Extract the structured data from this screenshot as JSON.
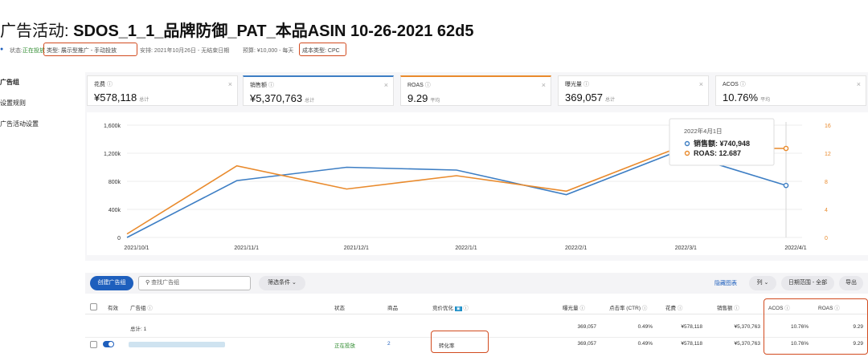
{
  "header": {
    "title_prefix": "广告活动: ",
    "title_name": "SDOS_1_1_品牌防御_PAT_本品ASIN 10-26-2021 62d5"
  },
  "status_bar": {
    "status_label": "状态:",
    "status_value": "正在投放",
    "type": "类型: 展示型推广 - 手动投放",
    "schedule": "安排: 2021年10月26日 - 无结束日期",
    "budget": "预算: ¥10,000 - 每天",
    "cost_type": "成本类型: CPC"
  },
  "sidebar": {
    "items": [
      {
        "label": "广告组"
      },
      {
        "label": "设置规则"
      },
      {
        "label": "广告活动设置"
      }
    ]
  },
  "metrics": [
    {
      "label": "花费",
      "value": "¥578,118",
      "suffix": "总计"
    },
    {
      "label": "销售额",
      "value": "¥5,370,763",
      "suffix": "总计"
    },
    {
      "label": "ROAS",
      "value": "9.29",
      "suffix": "平均"
    },
    {
      "label": "曝光量",
      "value": "369,057",
      "suffix": "总计"
    },
    {
      "label": "ACOS",
      "value": "10.76%",
      "suffix": "平均"
    }
  ],
  "chart_data": {
    "type": "line",
    "x": [
      "2021/10/1",
      "2021/11/1",
      "2021/12/1",
      "2022/1/1",
      "2022/2/1",
      "2022/3/1",
      "2022/4/1"
    ],
    "series": [
      {
        "name": "销售额",
        "color": "#3d7ec4",
        "axis": "left",
        "values": [
          0,
          810000,
          1000000,
          960000,
          610000,
          1220000,
          740948
        ]
      },
      {
        "name": "ROAS",
        "color": "#e98a2c",
        "axis": "right",
        "values": [
          0.5,
          10.2,
          6.9,
          8.8,
          6.6,
          12.7,
          12.687
        ]
      }
    ],
    "y_left": {
      "ticks": [
        "0",
        "400k",
        "800k",
        "1,200k",
        "1,600k"
      ],
      "max": 1600000
    },
    "y_right": {
      "ticks": [
        "0",
        "4",
        "8",
        "12",
        "16"
      ],
      "max": 16
    },
    "tooltip": {
      "date": "2022年4月1日",
      "sales_label": "销售额: ¥740,948",
      "roas_label": "ROAS: 12.687"
    }
  },
  "toolbar": {
    "create_button": "创建广告组",
    "search_placeholder": "查找广告组",
    "filter_button": "筛选条件",
    "hide_chart": "隐藏图表",
    "columns": "列",
    "date_range": "日期范围 - 全部",
    "export": "导出"
  },
  "table": {
    "headers": {
      "active": "有效",
      "ad_group": "广告组",
      "status": "状态",
      "products": "商品",
      "bid_opt": "竞价优化",
      "impressions": "曝光量",
      "ctr": "点击率 (CTR)",
      "spend": "花费",
      "sales": "销售额",
      "acos": "ACOS",
      "roas": "ROAS"
    },
    "total_row": {
      "label": "总计: 1",
      "impressions": "369,057",
      "ctr": "0.49%",
      "spend": "¥578,118",
      "sales": "¥5,370,763",
      "acos": "10.76%",
      "roas": "9.29"
    },
    "rows": [
      {
        "status": "正在投放",
        "products": "2",
        "bid_opt": "转化率",
        "impressions": "369,057",
        "ctr": "0.49%",
        "spend": "¥578,118",
        "sales": "¥5,370,763",
        "acos": "10.76%",
        "roas": "9.29"
      }
    ]
  }
}
